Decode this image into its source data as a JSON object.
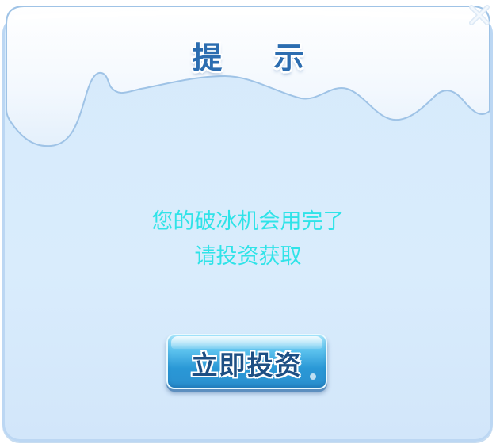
{
  "dialog": {
    "title": "提 示",
    "message_lines": [
      "您的破冰机会用完了",
      "请投资获取"
    ],
    "invest_button_label": "立即投资",
    "close_icon": "close-icon"
  },
  "colors": {
    "panel": "#d6eafb",
    "snow": "#f4f9ff",
    "title": "#2c6db0",
    "message": "#2fe3e8",
    "button": "#2a98d6"
  }
}
